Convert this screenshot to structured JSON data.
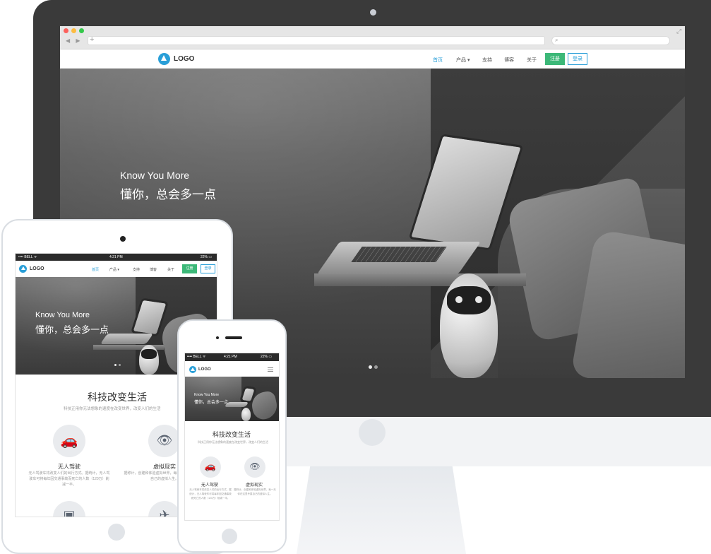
{
  "desktop": {
    "logo": "LOGO",
    "nav": [
      "首页",
      "产品 ▾",
      "支持",
      "博客",
      "关于"
    ],
    "register": "注册",
    "login": "登录",
    "hero_en": "Know You More",
    "hero_cn": "懂你，总会多一点"
  },
  "tablet": {
    "status_left": "•••• BELL ᯤ",
    "status_time": "4:21 PM",
    "status_right": "22% ▭",
    "logo": "LOGO",
    "nav": [
      "首页",
      "产品 ▾",
      "支持",
      "博客",
      "关于"
    ],
    "register": "注册",
    "login": "登录",
    "hero_en": "Know You More",
    "hero_cn": "懂你，总会多一点",
    "section_title": "科技改变生活",
    "section_sub": "科技正用你无法想象的速度在改变世界，改变人们的生活",
    "features": [
      {
        "title": "无人驾驶",
        "desc": "无人驾驶车将改变人们的出行方式。据统计，无人驾驶车可将每年因交通事故而死亡的人数（120万）削减一半。",
        "icon": "car-icon"
      },
      {
        "title": "虚拟现实",
        "desc": "据称计，创建和体验虚拟世界，每一天你在这里专属自己的虚拟人生。",
        "icon": "eye-icon"
      }
    ]
  },
  "phone": {
    "status_left": "•••• BELL ᯤ",
    "status_time": "4:21 PM",
    "status_right": "22% ▭",
    "logo": "LOGO",
    "hero_en": "Know You More",
    "hero_cn": "懂你，总会多一点",
    "section_title": "科技改变生活",
    "section_sub": "科技正用你无法想象的速度在改变世界，改变人们的生活",
    "features": [
      {
        "title": "无人驾驶",
        "desc": "无人驾驶车将改变人们的出行方式。据统计，无人驾驶车可将每年因交通事故而死亡的人数（120万）削减一半。",
        "icon": "car-icon"
      },
      {
        "title": "虚拟现实",
        "desc": "据称计，创建和体验虚拟世界，每一天你在这里专属自己的虚拟人生。",
        "icon": "eye-icon"
      }
    ]
  },
  "colors": {
    "accent": "#2a9fd8",
    "register": "#3cb878",
    "frame": "#3a3a3a"
  }
}
